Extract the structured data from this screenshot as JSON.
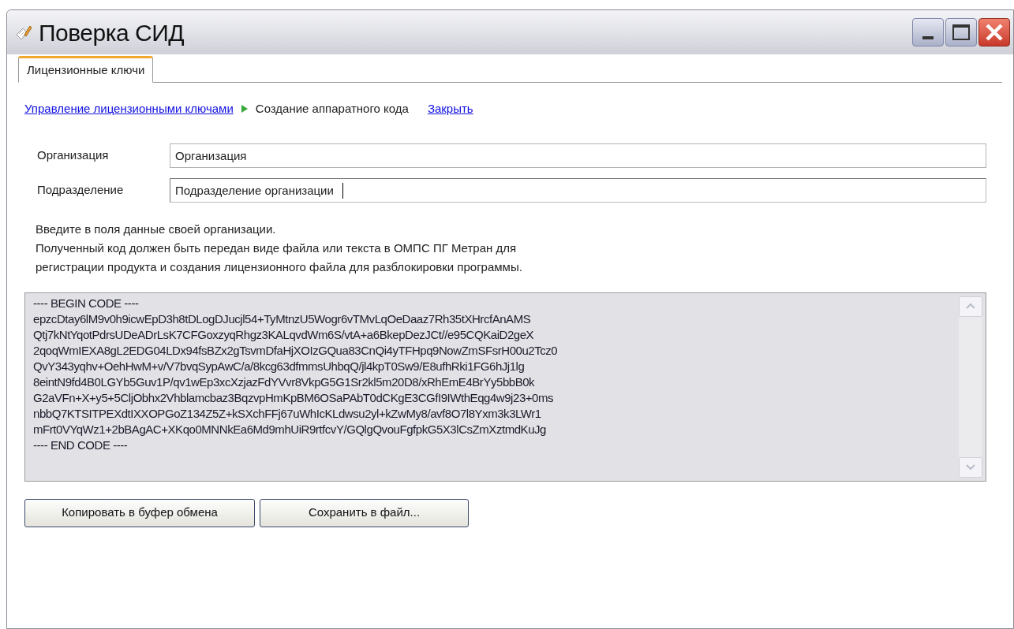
{
  "window": {
    "title": "Поверка СИД"
  },
  "tabs": [
    {
      "label": "Лицензионные ключи",
      "selected": true
    }
  ],
  "breadcrumb": {
    "link": "Управление лицензионными ключами",
    "current": "Создание аппаратного кода",
    "close_link": "Закрыть"
  },
  "fields": [
    {
      "label": "Организация",
      "value": "Организация",
      "focused": false
    },
    {
      "label": "Подразделение",
      "value": "Подразделение организации",
      "focused": true
    }
  ],
  "instructions": [
    "Введите в поля данные своей организации.",
    "Полученный код должен быть передан виде файла или текста в ОМПС ПГ Метран для",
    "регистрации продукта и создания лицензионного файла для разблокировки программы."
  ],
  "code": [
    "---- BEGIN CODE ----",
    "epzcDtay6lM9v0h9icwEpD3h8tDLogDJucjl54+TyMtnzU5Wogr6vTMvLqOeDaaz7Rh35tXHrcfAnAMS",
    "Qtj7kNtYqotPdrsUDeADrLsK7CFGoxzyqRhgz3KALqvdWm6S/vtA+a6BkepDezJCt//e95CQKaiD2geX",
    "2qoqWmIEXA8gL2EDG04LDx94fsBZx2gTsvmDfaHjXOIzGQua83CnQi4yTFHpq9NowZmSFsrH00u2Tcz0",
    "QvY343yqhv+OehHwM+v/V7bvqSypAwC/a/8kcg63dfmmsUhbqQ/jl4kpT0Sw9/E8ufhRki1FG6hJj1lg",
    "8eintN9fd4B0LGYb5Guv1P/qv1wEp3xcXzjazFdYVvr8VkpG5G1Sr2kl5m20D8/xRhEmE4BrYy5bbB0k",
    "G2aVFn+X+y5+5CljObhx2Vhblamcbaz3BqzvpHmKpBM6OSaPAbT0dCKgE3CGfI9IWthEqg4w9j23+0ms",
    "nbbQ7KTSITPEXdtIXXOPGoZ134Z5Z+kSXchFFj67uWhIcKLdwsu2yl+kZwMy8/avf8O7l8Yxm3k3LWr1",
    "mFrt0VYqWz1+2bBAgAC+XKqo0MNNkEa6Md9mhUiR9rtfcvY/GQlgQvouFgfpkG5X3lCsZmXztmdKuJg",
    "---- END CODE ----"
  ],
  "buttons": [
    "Копировать в буфер обмена",
    "Сохранить в файл..."
  ]
}
